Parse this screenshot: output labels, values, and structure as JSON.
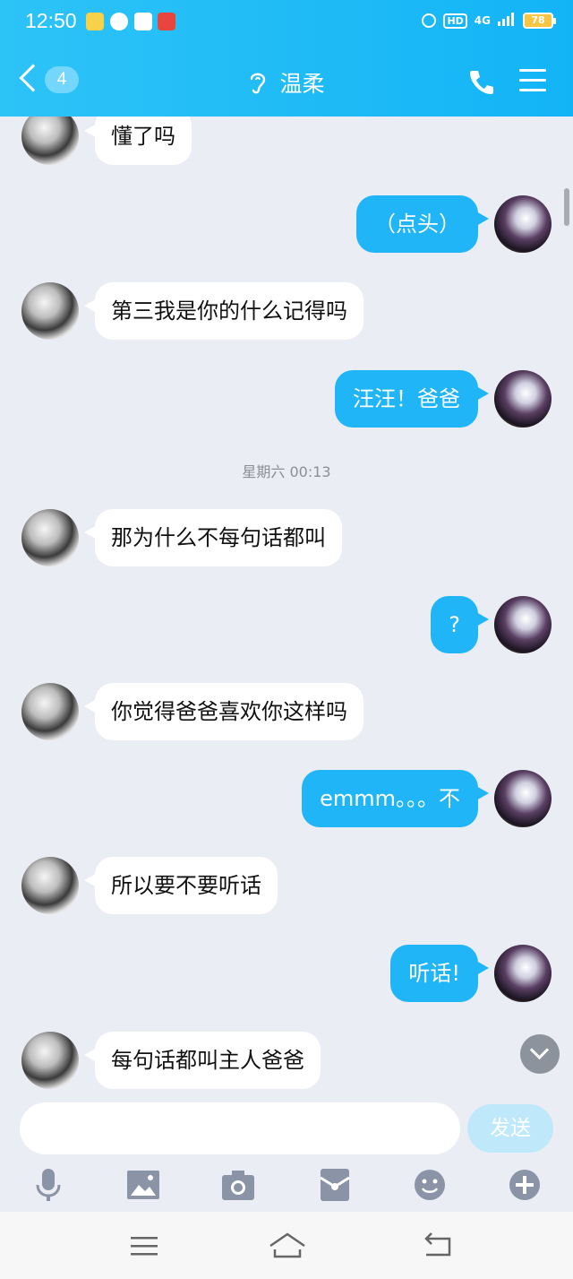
{
  "status_bar": {
    "time": "12:50",
    "hd": "HD",
    "network": "4G",
    "battery": "78"
  },
  "header": {
    "back_badge": "4",
    "title": "温柔"
  },
  "messages": [
    {
      "side": "left",
      "text": "懂了吗"
    },
    {
      "side": "right",
      "text": "（点头）"
    },
    {
      "side": "left",
      "text": "第三我是你的什么记得吗"
    },
    {
      "side": "right",
      "text": "汪汪！爸爸"
    },
    {
      "side": "time",
      "text": "星期六  00:13"
    },
    {
      "side": "left",
      "text": "那为什么不每句话都叫"
    },
    {
      "side": "right",
      "text": "?"
    },
    {
      "side": "left",
      "text": "你觉得爸爸喜欢你这样吗"
    },
    {
      "side": "right",
      "text": "emmm。。。不"
    },
    {
      "side": "left",
      "text": "所以要不要听话"
    },
    {
      "side": "right",
      "text": "听话!"
    },
    {
      "side": "left",
      "text": "每句话都叫主人爸爸"
    }
  ],
  "input": {
    "value": "",
    "placeholder": "",
    "send_label": "发送"
  },
  "colors": {
    "accent": "#20b5f7",
    "header": "#13b4f6",
    "background": "#eaedf4"
  }
}
